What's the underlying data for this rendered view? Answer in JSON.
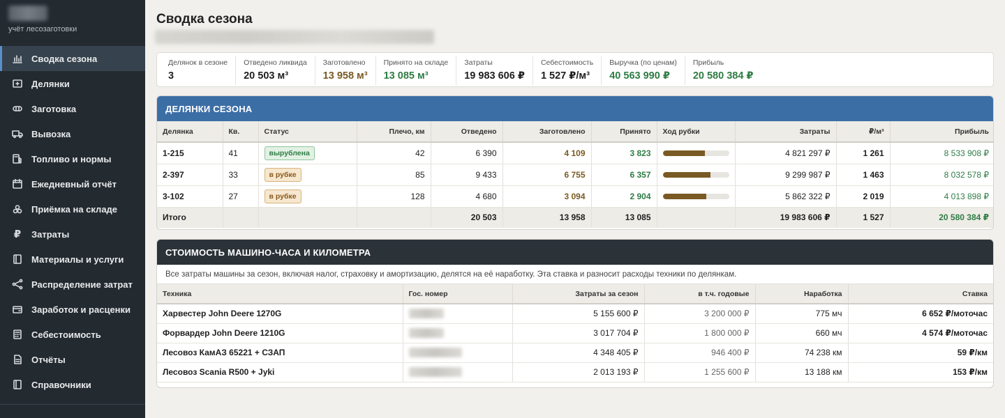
{
  "sidebar": {
    "brand_sub": "учёт лесозаготовки",
    "items": [
      {
        "label": "Сводка сезона",
        "icon": "bar-chart-icon",
        "active": true
      },
      {
        "label": "Делянки",
        "icon": "plot-icon"
      },
      {
        "label": "Заготовка",
        "icon": "log-icon"
      },
      {
        "label": "Вывозка",
        "icon": "truck-icon"
      },
      {
        "label": "Топливо и нормы",
        "icon": "fuel-icon"
      },
      {
        "label": "Ежедневный отчёт",
        "icon": "calendar-icon"
      },
      {
        "label": "Приёмка на складе",
        "icon": "stack-icon"
      },
      {
        "label": "Затраты",
        "icon": "ruble-icon"
      },
      {
        "label": "Материалы и услуги",
        "icon": "book-icon"
      },
      {
        "label": "Распределение затрат",
        "icon": "share-icon"
      },
      {
        "label": "Заработок и расценки",
        "icon": "wallet-icon"
      },
      {
        "label": "Себестоимость",
        "icon": "calculator-icon"
      },
      {
        "label": "Отчёты",
        "icon": "report-icon"
      },
      {
        "label": "Справочники",
        "icon": "book-icon"
      }
    ]
  },
  "page": {
    "title": "Сводка сезона"
  },
  "stats": [
    {
      "label": "Делянок в сезоне",
      "value": "3",
      "tone": ""
    },
    {
      "label": "Отведено ликвида",
      "value": "20 503 м³",
      "tone": ""
    },
    {
      "label": "Заготовлено",
      "value": "13 958 м³",
      "tone": "brown"
    },
    {
      "label": "Принято на складе",
      "value": "13 085 м³",
      "tone": "green"
    },
    {
      "label": "Затраты",
      "value": "19 983 606 ₽",
      "tone": ""
    },
    {
      "label": "Себестоимость",
      "value": "1 527 ₽/м³",
      "tone": ""
    },
    {
      "label": "Выручка (по ценам)",
      "value": "40 563 990 ₽",
      "tone": "green"
    },
    {
      "label": "Прибыль",
      "value": "20 580 384 ₽",
      "tone": "green"
    }
  ],
  "plots": {
    "title": "ДЕЛЯНКИ СЕЗОНА",
    "headers": [
      "Делянка",
      "Кв.",
      "Статус",
      "Плечо, км",
      "Отведено",
      "Заготовлено",
      "Принято",
      "Ход рубки",
      "Затраты",
      "₽/м³",
      "Прибыль"
    ],
    "rows": [
      {
        "plot": "1-215",
        "kv": "41",
        "status": "вырублена",
        "status_kind": "cut",
        "arm": "42",
        "allotted": "6 390",
        "harvested": "4 109",
        "accepted": "3 823",
        "progress": 0.64,
        "costs": "4 821 297 ₽",
        "per_m3": "1 261",
        "profit": "8 533 908 ₽"
      },
      {
        "plot": "2-397",
        "kv": "33",
        "status": "в рубке",
        "status_kind": "active",
        "arm": "85",
        "allotted": "9 433",
        "harvested": "6 755",
        "accepted": "6 357",
        "progress": 0.72,
        "costs": "9 299 987 ₽",
        "per_m3": "1 463",
        "profit": "8 032 578 ₽"
      },
      {
        "plot": "3-102",
        "kv": "27",
        "status": "в рубке",
        "status_kind": "active",
        "arm": "128",
        "allotted": "4 680",
        "harvested": "3 094",
        "accepted": "2 904",
        "progress": 0.66,
        "costs": "5 862 322 ₽",
        "per_m3": "2 019",
        "profit": "4 013 898 ₽"
      }
    ],
    "total": {
      "label": "Итого",
      "allotted": "20 503",
      "harvested": "13 958",
      "accepted": "13 085",
      "costs": "19 983 606 ₽",
      "per_m3": "1 527",
      "profit": "20 580 384 ₽"
    }
  },
  "machines": {
    "title": "СТОИМОСТЬ МАШИНО-ЧАСА И КИЛОМЕТРА",
    "note": "Все затраты машины за сезон, включая налог, страховку и амортизацию, делятся на её наработку. Эта ставка и разносит расходы техники по делянкам.",
    "headers": [
      "Техника",
      "Гос. номер",
      "Затраты за сезон",
      "в т.ч. годовые",
      "Наработка",
      "Ставка"
    ],
    "rows": [
      {
        "name": "Харвестер John Deere 1270G",
        "costs": "5 155 600 ₽",
        "annual": "3 200 000 ₽",
        "usage": "775 мч",
        "rate": "6 652 ₽/моточас"
      },
      {
        "name": "Форвардер John Deere 1210G",
        "costs": "3 017 704 ₽",
        "annual": "1 800 000 ₽",
        "usage": "660 мч",
        "rate": "4 574 ₽/моточас"
      },
      {
        "name": "Лесовоз КамАЗ 65221 + СЗАП",
        "costs": "4 348 405 ₽",
        "annual": "946 400 ₽",
        "usage": "74 238 км",
        "rate": "59 ₽/км"
      },
      {
        "name": "Лесовоз Scania R500 + Jyki",
        "costs": "2 013 193 ₽",
        "annual": "1 255 600 ₽",
        "usage": "13 188 км",
        "rate": "153 ₽/км"
      }
    ]
  },
  "colors": {
    "accent_blue": "#3c6ea6",
    "dark_header": "#2b3238",
    "brown": "#7a5a24",
    "green": "#2f7c45"
  }
}
